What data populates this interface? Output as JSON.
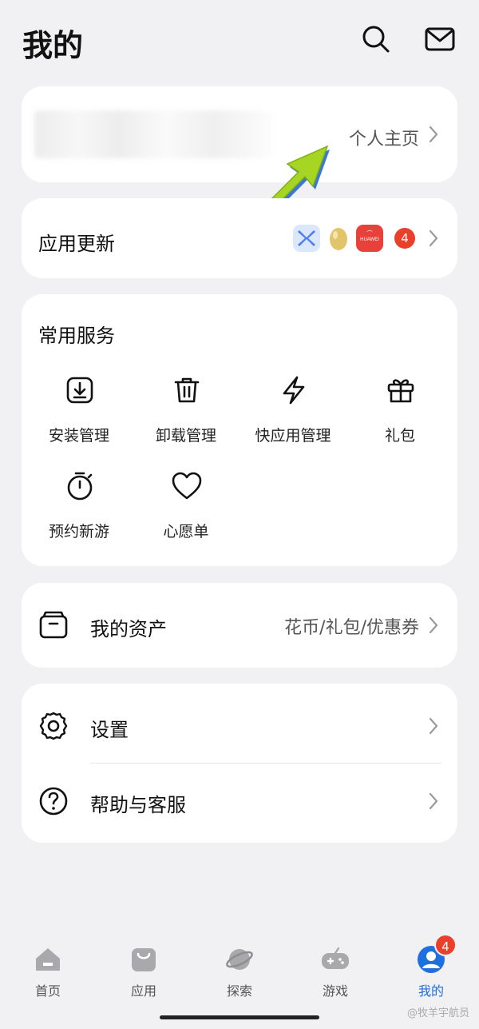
{
  "header": {
    "title": "我的",
    "search_icon": "search-icon",
    "mail_icon": "mail-icon"
  },
  "profile": {
    "link_label": "个人主页"
  },
  "updates": {
    "label": "应用更新",
    "badge_count": "4",
    "app_icons": [
      "x-app-icon",
      "egg-app-icon",
      "huawei-appgallery-icon"
    ],
    "huawei_text": "HUAWEI"
  },
  "services": {
    "title": "常用服务",
    "items": [
      {
        "label": "安装管理",
        "icon": "install-icon"
      },
      {
        "label": "卸载管理",
        "icon": "trash-icon"
      },
      {
        "label": "快应用管理",
        "icon": "quick-app-icon"
      },
      {
        "label": "礼包",
        "icon": "gift-icon"
      },
      {
        "label": "预约新游",
        "icon": "timer-icon"
      },
      {
        "label": "心愿单",
        "icon": "heart-icon"
      }
    ]
  },
  "assets": {
    "label": "我的资产",
    "detail": "花币/礼包/优惠券"
  },
  "settings": {
    "items": [
      {
        "label": "设置",
        "icon": "gear-icon"
      },
      {
        "label": "帮助与客服",
        "icon": "help-icon"
      }
    ]
  },
  "bottom_nav": {
    "items": [
      {
        "label": "首页",
        "icon": "home-icon"
      },
      {
        "label": "应用",
        "icon": "bag-icon"
      },
      {
        "label": "探索",
        "icon": "planet-icon"
      },
      {
        "label": "游戏",
        "icon": "gamepad-icon"
      },
      {
        "label": "我的",
        "icon": "user-icon",
        "active": true
      }
    ],
    "me_badge": "4"
  },
  "watermark": "@牧羊宇航员",
  "colors": {
    "accent": "#1e6fe0",
    "badge": "#e8402a",
    "background": "#f1f1f3",
    "annotation_arrow": "#a6d623"
  }
}
